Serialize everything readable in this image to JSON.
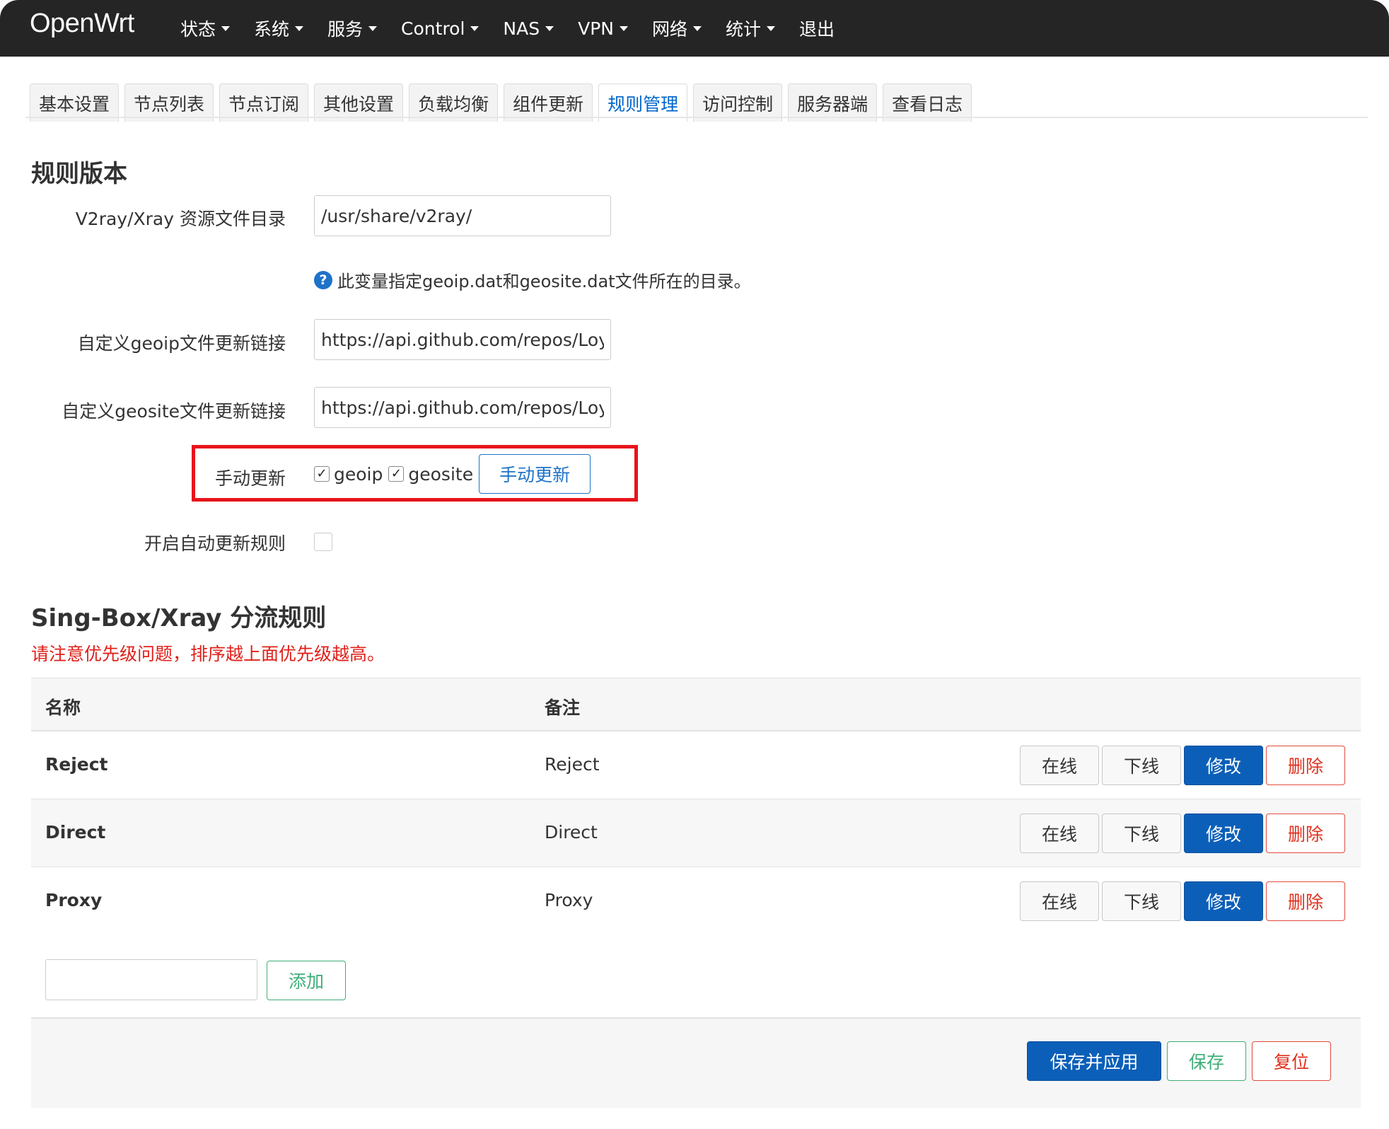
{
  "navbar": {
    "brand": "OpenWrt",
    "menu": [
      {
        "label": "状态",
        "dropdown": true
      },
      {
        "label": "系统",
        "dropdown": true
      },
      {
        "label": "服务",
        "dropdown": true
      },
      {
        "label": "Control",
        "dropdown": true
      },
      {
        "label": "NAS",
        "dropdown": true
      },
      {
        "label": "VPN",
        "dropdown": true
      },
      {
        "label": "网络",
        "dropdown": true
      },
      {
        "label": "统计",
        "dropdown": true
      },
      {
        "label": "退出",
        "dropdown": false
      }
    ]
  },
  "tabs": [
    {
      "label": "基本设置",
      "active": false
    },
    {
      "label": "节点列表",
      "active": false
    },
    {
      "label": "节点订阅",
      "active": false
    },
    {
      "label": "其他设置",
      "active": false
    },
    {
      "label": "负载均衡",
      "active": false
    },
    {
      "label": "组件更新",
      "active": false
    },
    {
      "label": "规则管理",
      "active": true
    },
    {
      "label": "访问控制",
      "active": false
    },
    {
      "label": "服务器端",
      "active": false
    },
    {
      "label": "查看日志",
      "active": false
    }
  ],
  "rules_version": {
    "title": "规则版本",
    "asset_dir_label": "V2ray/Xray 资源文件目录",
    "asset_dir_value": "/usr/share/v2ray/",
    "asset_dir_help": "此变量指定geoip.dat和geosite.dat文件所在的目录。",
    "geoip_url_label": "自定义geoip文件更新链接",
    "geoip_url_value": "https://api.github.com/repos/Loyal",
    "geosite_url_label": "自定义geosite文件更新链接",
    "geosite_url_value": "https://api.github.com/repos/Loyal",
    "manual_update_label": "手动更新",
    "geoip_checkbox": {
      "label": "geoip",
      "checked": true
    },
    "geosite_checkbox": {
      "label": "geosite",
      "checked": true
    },
    "manual_update_button": "手动更新",
    "auto_update_label": "开启自动更新规则",
    "auto_update_checked": false
  },
  "routing": {
    "title": "Sing-Box/Xray 分流规则",
    "warning": "请注意优先级问题，排序越上面优先级越高。",
    "columns": [
      "名称",
      "备注"
    ],
    "rows": [
      {
        "name": "Reject",
        "remark": "Reject"
      },
      {
        "name": "Direct",
        "remark": "Direct"
      },
      {
        "name": "Proxy",
        "remark": "Proxy"
      }
    ],
    "row_actions": {
      "online": "在线",
      "offline": "下线",
      "edit": "修改",
      "delete": "删除"
    },
    "add_placeholder": "",
    "add_button": "添加"
  },
  "footer": {
    "save_apply": "保存并应用",
    "save": "保存",
    "reset": "复位"
  },
  "colors": {
    "navbar_bg": "#252525",
    "active_tab": "#0066cc",
    "primary": "#0c5fb8",
    "danger": "#e0301e",
    "success": "#3fae78",
    "warning_text": "#e0201a",
    "highlight_box": "#e8141c"
  }
}
